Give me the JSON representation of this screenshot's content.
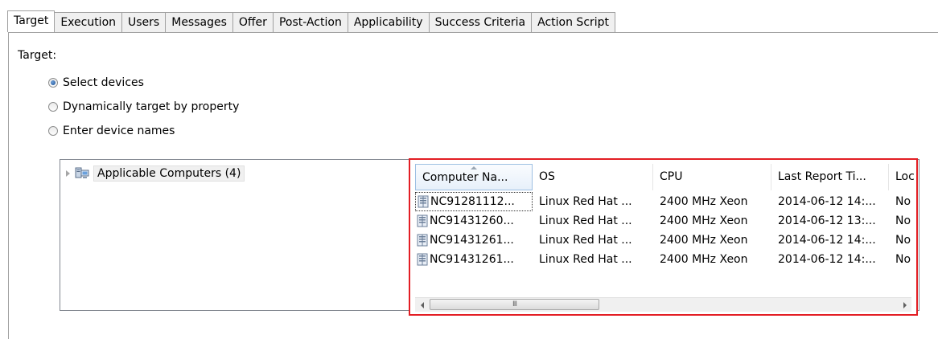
{
  "tabs": [
    {
      "label": "Target",
      "active": true
    },
    {
      "label": "Execution"
    },
    {
      "label": "Users"
    },
    {
      "label": "Messages"
    },
    {
      "label": "Offer"
    },
    {
      "label": "Post-Action"
    },
    {
      "label": "Applicability"
    },
    {
      "label": "Success Criteria"
    },
    {
      "label": "Action Script"
    }
  ],
  "target_label": "Target:",
  "radios": [
    {
      "label": "Select devices",
      "checked": true
    },
    {
      "label": "Dynamically target by property",
      "checked": false
    },
    {
      "label": "Enter device names",
      "checked": false
    }
  ],
  "tree": {
    "label": "Applicable Computers (4)",
    "icon": "computer-group-icon"
  },
  "list": {
    "columns": [
      "Computer Na...",
      "OS",
      "CPU",
      "Last Report Ti...",
      "Loc"
    ],
    "sorted_column": "Computer Na...",
    "rows": [
      [
        "NC91281112...",
        "Linux Red Hat ...",
        "2400 MHz Xeon",
        "2014-06-12 14:...",
        "No"
      ],
      [
        "NC91431260...",
        "Linux Red Hat ...",
        "2400 MHz Xeon",
        "2014-06-12 13:...",
        "No"
      ],
      [
        "NC91431261...",
        "Linux Red Hat ...",
        "2400 MHz Xeon",
        "2014-06-12 14:...",
        "No"
      ],
      [
        "NC91431261...",
        "Linux Red Hat ...",
        "2400 MHz Xeon",
        "2014-06-12 14:...",
        "No"
      ]
    ],
    "selected_row": 0,
    "highlight_color": "#e31e24"
  },
  "scrollbar": {
    "grip": "III"
  }
}
